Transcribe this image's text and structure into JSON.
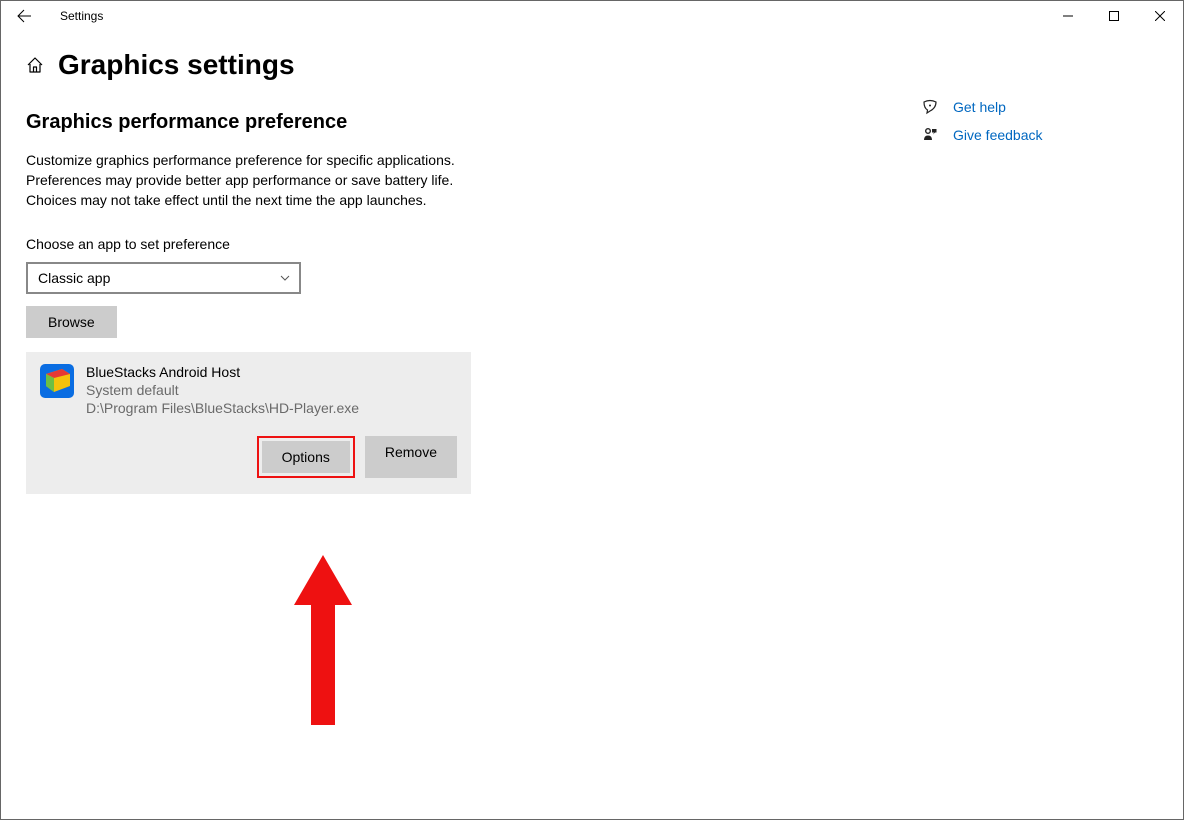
{
  "window": {
    "app_title": "Settings"
  },
  "page": {
    "title": "Graphics settings",
    "section_heading": "Graphics performance preference",
    "description": "Customize graphics performance preference for specific applications. Preferences may provide better app performance or save battery life. Choices may not take effect until the next time the app launches.",
    "picker_label": "Choose an app to set preference",
    "picker_value": "Classic app",
    "browse_button": "Browse"
  },
  "app_entry": {
    "name": "BlueStacks Android Host",
    "pref": "System default",
    "path": "D:\\Program Files\\BlueStacks\\HD-Player.exe",
    "options_button": "Options",
    "remove_button": "Remove"
  },
  "side": {
    "help_label": "Get help",
    "feedback_label": "Give feedback"
  }
}
